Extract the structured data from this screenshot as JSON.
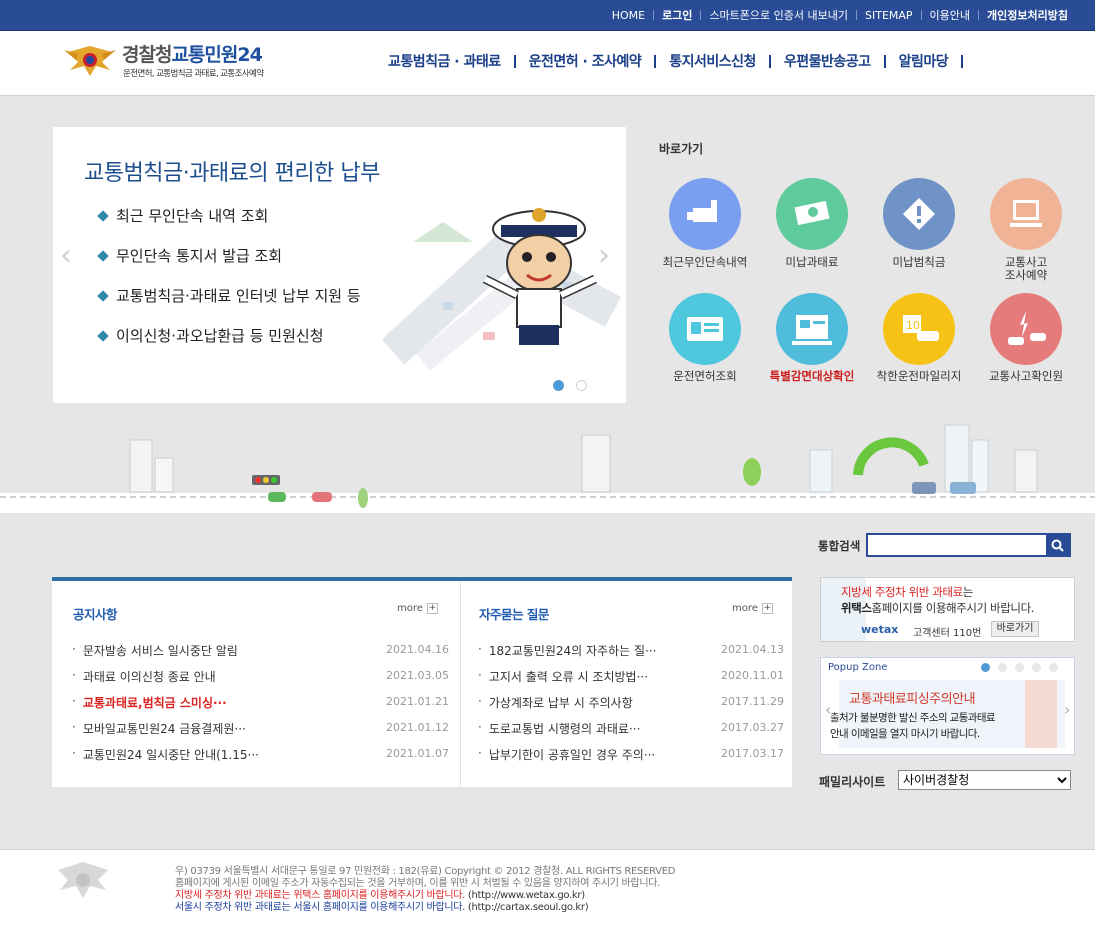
{
  "topnav": {
    "items": [
      "HOME",
      "로그인",
      "스마트폰으로 인증서 내보내기",
      "SITEMAP",
      "이용안내",
      "개인정보처리방침"
    ]
  },
  "logo": {
    "title_a": "경찰청",
    "title_b": "교통민원24",
    "subtitle": "운전면허, 교통범칙금 과태료, 교통조사예약"
  },
  "gnb": {
    "items": [
      "교통범칙금 · 과태료",
      "운전면허 · 조사예약",
      "통지서비스신청",
      "우편물반송공고",
      "알림마당"
    ]
  },
  "slider": {
    "title": "교통범칙금·과태료의 편리한 납부",
    "items": [
      "최근 무인단속 내역 조회",
      "무인단속 통지서 발급 조회",
      "교통범칙금·과태료 인터넷 납부 지원 등",
      "이의신청·과오납환급 등 민원신청"
    ],
    "active_index": 0
  },
  "quick": {
    "title": "바로가기",
    "items": [
      {
        "label": "최근무인단속내역",
        "icon": "camera-icon",
        "color": "#7b9ff0"
      },
      {
        "label": "미납과태료",
        "icon": "money-icon",
        "color": "#5fca9c"
      },
      {
        "label": "미납범칙금",
        "icon": "warning-icon",
        "color": "#6f93c6"
      },
      {
        "label": "교통사고 조사예약",
        "icon": "computer-icon",
        "color": "#f0b396"
      },
      {
        "label": "운전면허조회",
        "icon": "license-card-icon",
        "color": "#4fc8dd"
      },
      {
        "label": "특별감면대상확인",
        "icon": "document-search-icon",
        "color": "#4fbcdc"
      },
      {
        "label": "착한운전마일리지",
        "icon": "mileage-car-icon",
        "color": "#f6c216"
      },
      {
        "label": "교통사고확인원",
        "icon": "car-crash-icon",
        "color": "#e57b7b"
      }
    ]
  },
  "search": {
    "label": "통합검색",
    "placeholder": ""
  },
  "notice": {
    "title": "공지사항",
    "more": "more",
    "rows": [
      {
        "text": "문자발송 서비스 일시중단 알림",
        "date": "2021.04.16"
      },
      {
        "text": "과태료 이의신청 종료 안내",
        "date": "2021.03.05"
      },
      {
        "text": "교통과태료,범칙금 스미싱···",
        "date": "2021.01.21"
      },
      {
        "text": "모바일교통민원24 금융결제원···",
        "date": "2021.01.12"
      },
      {
        "text": "교통민원24 일시중단 안내(1.15···",
        "date": "2021.01.07"
      }
    ]
  },
  "faq": {
    "title": "자주묻는 질문",
    "more": "more",
    "rows": [
      {
        "text": "182교통민원24의 자주하는 질···",
        "date": "2021.04.13"
      },
      {
        "text": "고지서 출력 오류 시 조치방법···",
        "date": "2020.11.01"
      },
      {
        "text": "가상계좌로 납부 시 주의사항",
        "date": "2017.11.29"
      },
      {
        "text": "도로교통법 시행령의 과태료···",
        "date": "2017.03.27"
      },
      {
        "text": "납부기한이 공휴일인 경우 주의···",
        "date": "2017.03.17"
      }
    ]
  },
  "banner": {
    "line1_red": "지방세 주정차 위반 과태료",
    "line1_rest": "는",
    "line2_bold": "위택스",
    "line2_rest": "홈페이지를 이용해주시기 바랍니다.",
    "brand": "wetax",
    "center": "고객센터 110번",
    "button": "바로가기"
  },
  "popup": {
    "title": "Popup Zone",
    "heading": "교통과태료피싱주의안내",
    "body1": "출처가 불분명한 발신 주소의 교통과태료",
    "body2": "안내 이메일을 열지 마시기 바랍니다.",
    "active_index": 0
  },
  "family": {
    "label": "패밀리사이트",
    "selected": "사이버경찰청"
  },
  "footer": {
    "line1": "우) 03739 서울특별시 서대문구 통일로 97  민원전화 : 182(유료)     Copyright © 2012 경찰청. ALL RIGHTS RESERVED",
    "line2": "홈페이지에 게시된 이메일 주소가 자동수집되는 것을 거부하며, 이를 위반 시 처벌될 수 있음을 양지하여 주시기 바랍니다.",
    "line3_red": "지방세 주정차 위반 과태료는 위택스 홈페이지를 이용해주시기 바랍니다.",
    "line3_link": "(http://www.wetax.go.kr)",
    "line4_blue": "서울시 주정차 위반 과태료는 서울시 홈페이지를 이용해주시기 바랍니다.",
    "line4_link": "(http://cartax.seoul.go.kr)"
  }
}
